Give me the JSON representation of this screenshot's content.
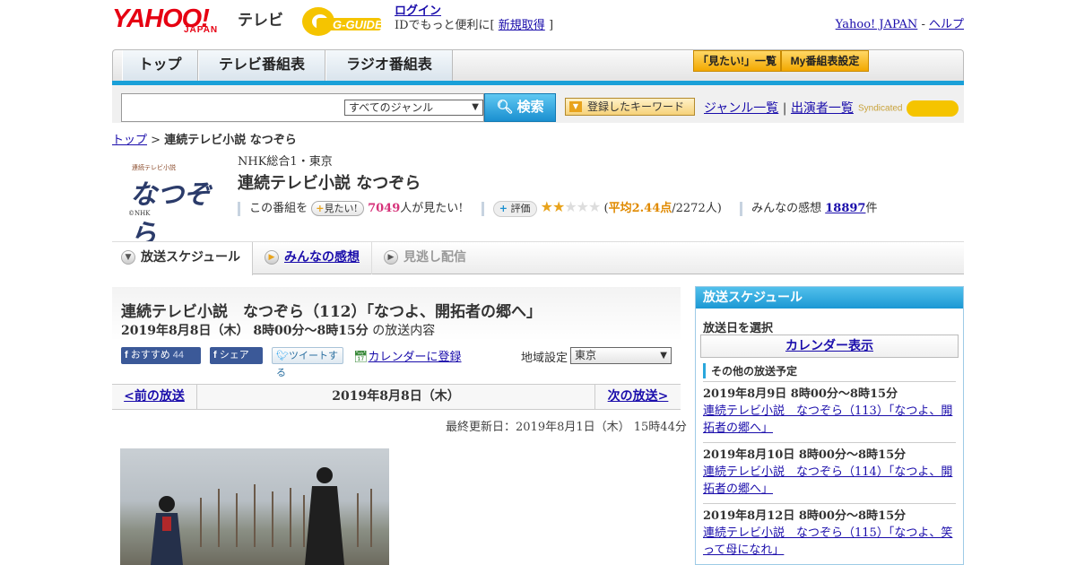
{
  "header": {
    "yahoo_logo": "YAHOO!",
    "yahoo_sub": "JAPAN",
    "tv_label": "テレビ",
    "gguide_logo": "G-GUIDE",
    "login": "ログイン",
    "login_text": "IDでもっと便利に[",
    "signup": "新規取得",
    "login_close": "]",
    "yahoo_japan_link": "Yahoo! JAPAN",
    "dash": "-",
    "help_link": "ヘルプ"
  },
  "nav": {
    "tabs": [
      "トップ",
      "テレビ番組表",
      "ラジオ番組表"
    ],
    "want_list": "「見たい!」一覧",
    "my_schedule": "My番組表設定"
  },
  "search": {
    "genre_selected": "すべてのジャンル",
    "search_button": "検索",
    "keyword_button": "登録したキーワード",
    "genre_list": "ジャンル一覧",
    "sep": "|",
    "cast_list": "出演者一覧",
    "syndicated": "Syndicated"
  },
  "breadcrumb": {
    "top": "トップ",
    "sep": ">",
    "current": "連続テレビ小説 なつぞら"
  },
  "program": {
    "logo_text": "なつぞら",
    "logo_small": "連続テレビ小説",
    "logo_copy": "©NHK",
    "channel": "NHK総合1・東京",
    "title": "連続テレビ小説 なつぞら",
    "want_prefix": "この番組を",
    "want_button": "見たい!",
    "want_count": "7049",
    "want_suffix": "人が見たい!",
    "rate_button": "評価",
    "rating_stars": 2.44,
    "rating_open": "(",
    "rating_avg": "平均2.44点",
    "rating_people": "/2272人)",
    "reviews_prefix": "みんなの感想",
    "reviews_count": "18897",
    "reviews_suffix": "件"
  },
  "tabs": {
    "schedule": "放送スケジュール",
    "reviews": "みんなの感想",
    "vod": "見逃し配信"
  },
  "episode": {
    "title": "連続テレビ小説　なつぞら（112）「なつよ、開拓者の郷へ」",
    "date_time": "2019年8月8日（木） 8時00分～8時15分",
    "date_suffix": "の放送内容",
    "recommend": "おすすめ",
    "recommend_count": "44",
    "share": "シェア",
    "tweet": "ツイートする",
    "calendar_add": "カレンダーに登録",
    "region_label": "地域設定",
    "region_value": "東京",
    "prev": "<前の放送",
    "current_date": "2019年8月8日（木）",
    "next": "次の放送>",
    "updated": "最終更新日：2019年8月1日（木） 15時44分"
  },
  "sidebar": {
    "title": "放送スケジュール",
    "date_label": "放送日を選択",
    "calendar": "カレンダー表示",
    "other_label": "その他の放送予定",
    "items": [
      {
        "time": "2019年8月9日 8時00分～8時15分",
        "title": "連続テレビ小説　なつぞら（113）「なつよ、開拓者の郷へ」"
      },
      {
        "time": "2019年8月10日 8時00分～8時15分",
        "title": "連続テレビ小説　なつぞら（114）「なつよ、開拓者の郷へ」"
      },
      {
        "time": "2019年8月12日 8時00分～8時15分",
        "title": "連続テレビ小説　なつぞら（115）「なつよ、笑って母になれ」"
      }
    ]
  }
}
